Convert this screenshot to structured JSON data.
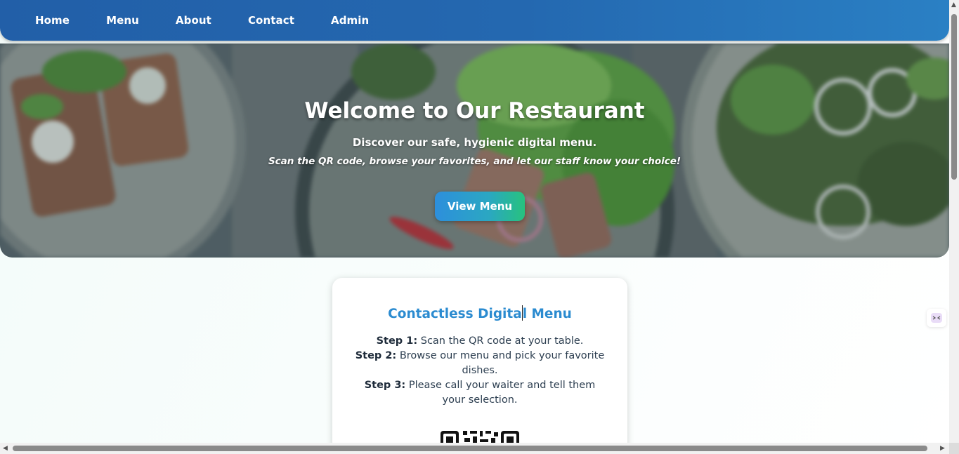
{
  "nav": {
    "items": [
      "Home",
      "Menu",
      "About",
      "Contact",
      "Admin"
    ]
  },
  "hero": {
    "title": "Welcome to Our Restaurant",
    "subtitle": "Discover our safe, hygienic digital menu.",
    "note": "Scan the QR code, browse your favorites, and let our staff know your choice!",
    "button_label": "View Menu"
  },
  "card": {
    "title_part1": "Contactless Digita",
    "title_part2": "l Menu",
    "steps": [
      {
        "label": "Step 1:",
        "text": "Scan the QR code at your table."
      },
      {
        "label": "Step 2:",
        "text": "Browse our menu and pick your favorite dishes."
      },
      {
        "label": "Step 3:",
        "text": "Please call your waiter and tell them your selection."
      }
    ]
  },
  "colors": {
    "nav_bg": "#225fa8",
    "accent": "#2b8bd0",
    "button_start": "#2d8fdc",
    "button_end": "#27c27e"
  },
  "icons": {
    "widget": "assistant-icon",
    "qr": "qr-code-icon"
  }
}
